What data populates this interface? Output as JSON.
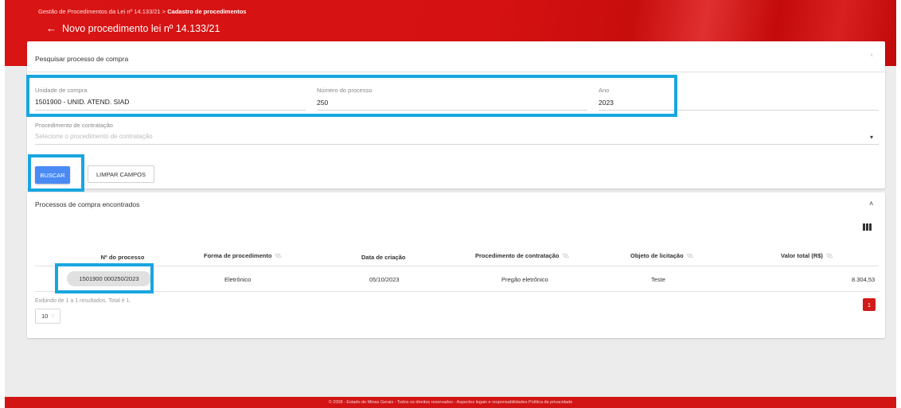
{
  "header": {
    "breadcrumb_parent": "Gestão de Procedimentos da Lei nº 14.133/21",
    "breadcrumb_sep": ">",
    "breadcrumb_current": "Cadastro de procedimentos",
    "back_icon": "←",
    "title": "Novo procedimento lei nº 14.133/21"
  },
  "search": {
    "title": "Pesquisar processo de compra",
    "unidade_label": "Unidade de compra",
    "unidade_value": "1501900 - UNID. ATEND. SIAD",
    "numero_label": "Número do processo",
    "numero_value": "250",
    "ano_label": "Ano",
    "ano_value": "2023",
    "procedimento_label": "Procedimento de contratação",
    "procedimento_placeholder": "Selecione o procedimento de contratação",
    "buscar_label": "BUSCAR",
    "limpar_label": "LIMPAR CAMPOS"
  },
  "results": {
    "title": "Processos de compra encontrados",
    "columns": [
      "Nº do processo",
      "Forma de procedimento",
      "Data de criação",
      "Procedimento de contratação",
      "Objeto de licitação",
      "Valor total (R$)"
    ],
    "rows": [
      [
        "1501900 000250/2023",
        "Eletrônico",
        "05/10/2023",
        "Pregão eletrônico",
        "Teste",
        "8.304,53"
      ]
    ],
    "info": "Exibindo de 1 a 1 resultados. Total é 1.",
    "page_size": "10",
    "current_page": "1"
  },
  "footer": {
    "text": "© 2008 - Estado de Minas Gerais - Todos os direitos reservados - Aspectos legais e responsabilidades  Política de privacidade"
  },
  "colors": {
    "brand_red": "#d21414",
    "primary_button": "#4a8af4",
    "highlight": "#18a6e0"
  }
}
